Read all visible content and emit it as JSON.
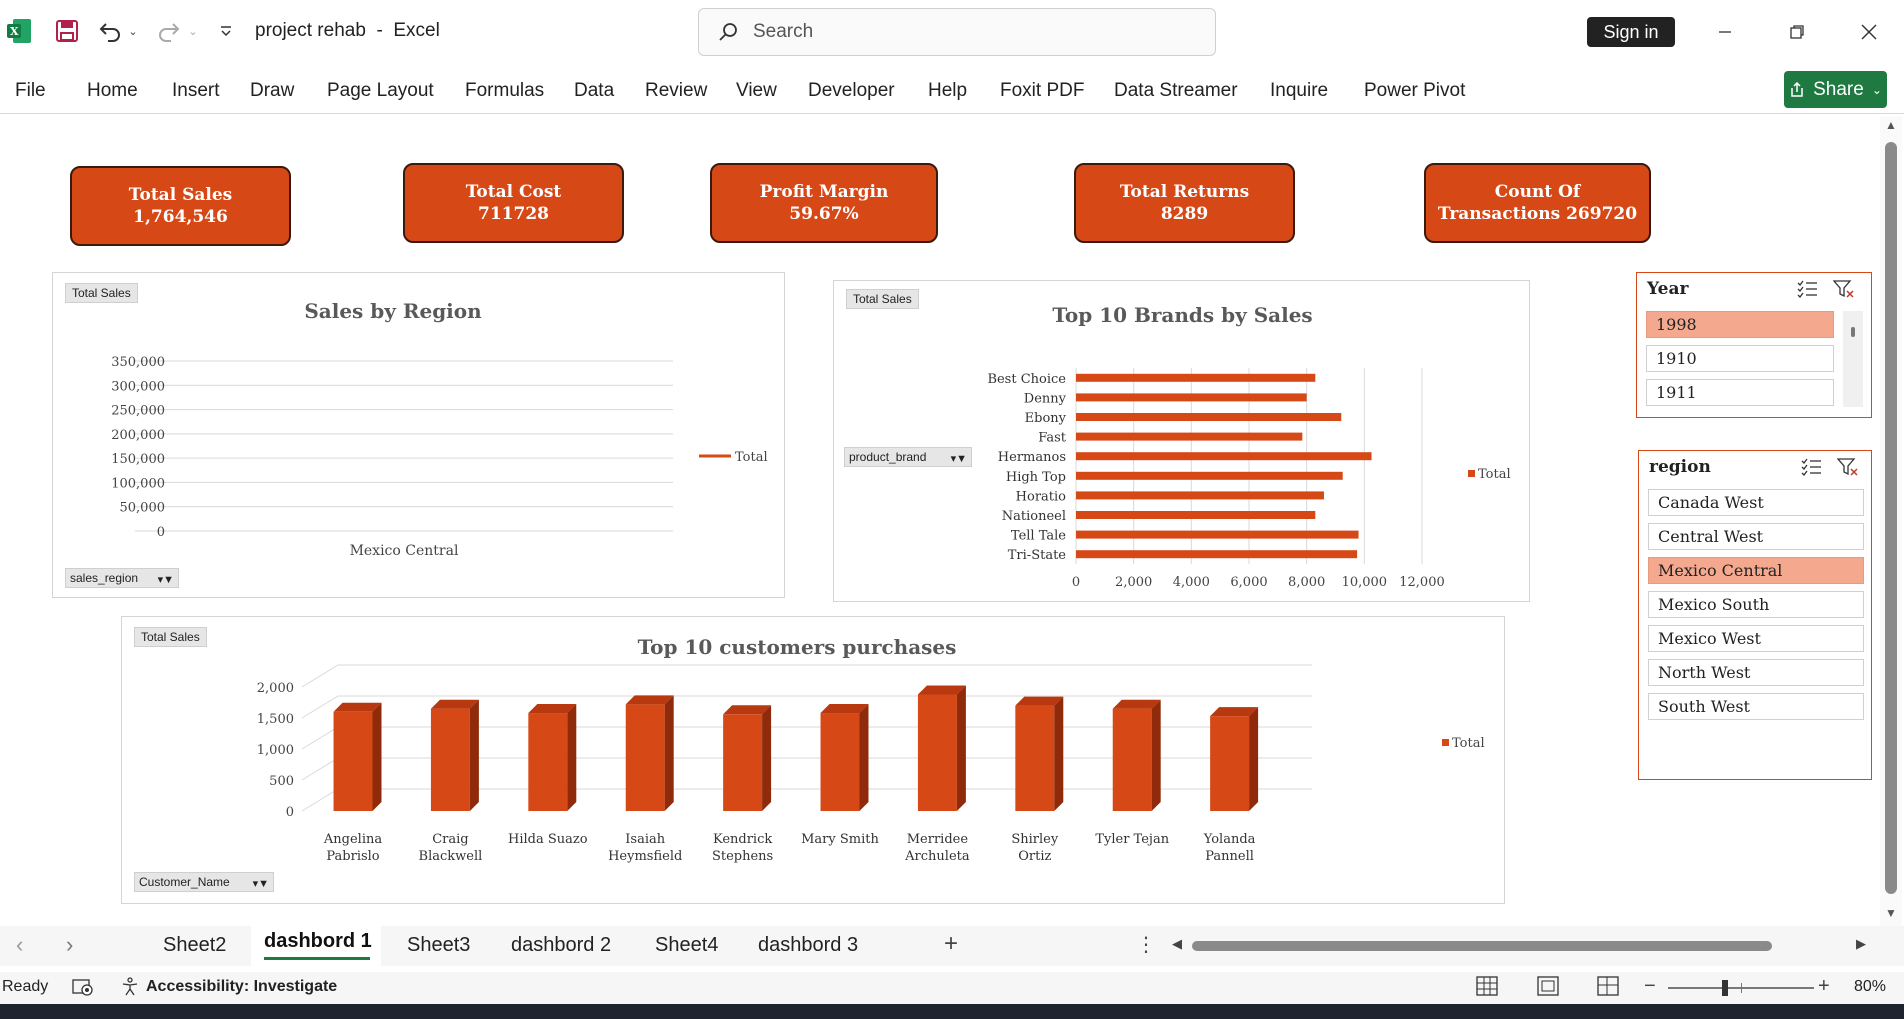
{
  "app": {
    "doc_title": "project rehab",
    "app_name": "Excel",
    "search_placeholder": "Search",
    "sign_in": "Sign in",
    "share": "Share"
  },
  "menu": [
    "File",
    "Home",
    "Insert",
    "Draw",
    "Page Layout",
    "Formulas",
    "Data",
    "Review",
    "View",
    "Developer",
    "Help",
    "Foxit PDF",
    "Data Streamer",
    "Inquire",
    "Power Pivot"
  ],
  "kpis": [
    {
      "label": "Total Sales",
      "value": "1,764,546"
    },
    {
      "label": "Total Cost",
      "value": "711728"
    },
    {
      "label": "Profit Margin",
      "value": "59.67%"
    },
    {
      "label": "Total Returns",
      "value": "8289"
    },
    {
      "label": "Count Of",
      "value": "Transactions 269720"
    }
  ],
  "colors": {
    "accent": "#d64917",
    "slicer_selected": "#f4a98f",
    "excel_green": "#1f7a42"
  },
  "region_chart": {
    "field_value": "Total Sales",
    "field_axis": "sales_region",
    "legend": "Total",
    "chart_data": {
      "type": "line",
      "title": "Sales by Region",
      "categories": [
        "Mexico Central"
      ],
      "series": [
        {
          "name": "Total",
          "values": []
        }
      ],
      "ylim": [
        0,
        350000
      ],
      "yticks": [
        "350,000",
        "300,000",
        "250,000",
        "200,000",
        "150,000",
        "100,000",
        "50,000",
        "0"
      ],
      "legend_position": "right"
    }
  },
  "brands_chart": {
    "field_value": "Total Sales",
    "field_axis": "product_brand",
    "legend": "Total",
    "chart_data": {
      "type": "bar",
      "orientation": "horizontal",
      "title": "Top 10 Brands by Sales",
      "categories": [
        "Best Choice",
        "Denny",
        "Ebony",
        "Fast",
        "Hermanos",
        "High Top",
        "Horatio",
        "Nationeel",
        "Tell Tale",
        "Tri-State"
      ],
      "values": [
        8300,
        8000,
        9200,
        7850,
        10250,
        9250,
        8600,
        8300,
        9800,
        9750
      ],
      "xlim": [
        0,
        12000
      ],
      "xticks": [
        "0",
        "2,000",
        "4,000",
        "6,000",
        "8,000",
        "10,000",
        "12,000"
      ],
      "series_name": "Total",
      "legend_position": "right"
    }
  },
  "customers_chart": {
    "field_value": "Total Sales",
    "field_axis": "Customer_Name",
    "legend": "Total",
    "chart_data": {
      "type": "bar",
      "title": "Top 10 customers purchases",
      "categories": [
        [
          "Angelina",
          "Pabrislo"
        ],
        [
          "Craig",
          "Blackwell"
        ],
        [
          "Hilda  Suazo"
        ],
        [
          "Isaiah",
          "Heymsfield"
        ],
        [
          "Kendrick",
          "Stephens"
        ],
        [
          "Mary  Smith"
        ],
        [
          "Merridee",
          "Archuleta"
        ],
        [
          "Shirley",
          "Ortiz"
        ],
        [
          "Tyler  Tejan"
        ],
        [
          "Yolanda",
          "Pannell"
        ]
      ],
      "values": [
        1600,
        1650,
        1580,
        1720,
        1560,
        1580,
        1880,
        1700,
        1650,
        1530
      ],
      "ylim": [
        0,
        2000
      ],
      "yticks": [
        "2,000",
        "1,500",
        "1,000",
        "500",
        "0"
      ],
      "series_name": "Total",
      "legend_position": "right"
    }
  },
  "year_slicer": {
    "title": "Year",
    "items": [
      {
        "label": "1998",
        "selected": true
      },
      {
        "label": "1910",
        "selected": false
      },
      {
        "label": "1911",
        "selected": false
      }
    ]
  },
  "region_slicer": {
    "title": "region",
    "items": [
      {
        "label": "Canada West",
        "selected": false
      },
      {
        "label": "Central West",
        "selected": false
      },
      {
        "label": "Mexico Central",
        "selected": true
      },
      {
        "label": "Mexico South",
        "selected": false
      },
      {
        "label": "Mexico West",
        "selected": false
      },
      {
        "label": "North West",
        "selected": false
      },
      {
        "label": "South West",
        "selected": false
      }
    ]
  },
  "sheets": [
    {
      "label": "Sheet2",
      "active": false
    },
    {
      "label": "dashbord 1",
      "active": true
    },
    {
      "label": "Sheet3",
      "active": false
    },
    {
      "label": "dashbord 2",
      "active": false
    },
    {
      "label": "Sheet4",
      "active": false
    },
    {
      "label": "dashbord 3",
      "active": false
    }
  ],
  "status": {
    "ready": "Ready",
    "accessibility": "Accessibility: Investigate",
    "zoom": "80%"
  }
}
